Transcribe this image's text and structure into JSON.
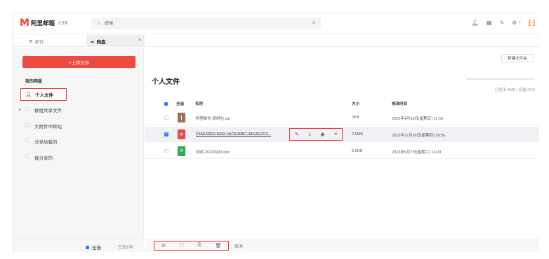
{
  "brand": {
    "logo_mark": "M",
    "name": "阿里邮箱",
    "badge": "企业版"
  },
  "search": {
    "placeholder": "搜索",
    "icon": "search-icon",
    "filter_icon": "filter-icon"
  },
  "toolbar": {
    "icons": [
      "bell-icon",
      "calendar-icon",
      "pen-icon",
      "gear-icon",
      "aliyun-brand-icon"
    ],
    "brand_glyph": "[-]",
    "accent": "#ff6a00"
  },
  "tabs": [
    {
      "label": "邮件",
      "icon": "mail-icon",
      "active": false
    },
    {
      "label": "网盘",
      "icon": "cloud-icon",
      "active": true,
      "close": "×"
    }
  ],
  "sidebar": {
    "upload_label": "+上传文件",
    "section_title": "我的网盘",
    "items": [
      {
        "label": "个人文件",
        "icon": "user-icon",
        "active": true
      },
      {
        "label": "群组共享文件",
        "icon": "folder-icon",
        "expandable": true
      },
      {
        "label": "大附件中转站",
        "icon": "folder-icon"
      },
      {
        "label": "分享给我的",
        "icon": "folder-icon"
      },
      {
        "label": "我分享的",
        "icon": "folder-icon"
      }
    ],
    "footer": {
      "select_all": "全选",
      "selected_count": "已选1项"
    }
  },
  "main": {
    "new_folder_label": "新建文件夹",
    "title": "个人文件",
    "storage_text": "已使用 4MB / 容量 2GB",
    "storage_used_fraction": 0.002,
    "columns": {
      "select_all": "全选",
      "name": "名称",
      "size": "大小",
      "modified": "修改时间"
    },
    "files": [
      {
        "name": "阿里邮件.资料包.zip",
        "icon": "zip-file-icon",
        "size": "2KB",
        "modified": "2023年4月28日(星期五) 11:59",
        "selected": false
      },
      {
        "name": "F3AE53DD-8342-4AC9-B2B7-48CAD7C9...",
        "icon": "pdf-file-icon",
        "size": "3.5MB",
        "modified": "2022年12月28日(星期四) 09:56",
        "selected": true
      },
      {
        "name": "测试-20220930.xlsx",
        "icon": "excel-file-icon",
        "size": "5.5KB",
        "modified": "2022年5月7日(星期六) 14:23",
        "selected": false
      }
    ],
    "row_actions": [
      "edit-icon",
      "download-icon",
      "preview-icon",
      "share-icon"
    ],
    "bottom_actions": [
      "send-mail-icon",
      "move-icon",
      "copy-icon",
      "delete-icon"
    ],
    "cancel_label": "取消"
  },
  "colors": {
    "primary_red": "#ec4a43",
    "highlight_red": "#e53935",
    "selection_blue": "#3b82f6"
  }
}
